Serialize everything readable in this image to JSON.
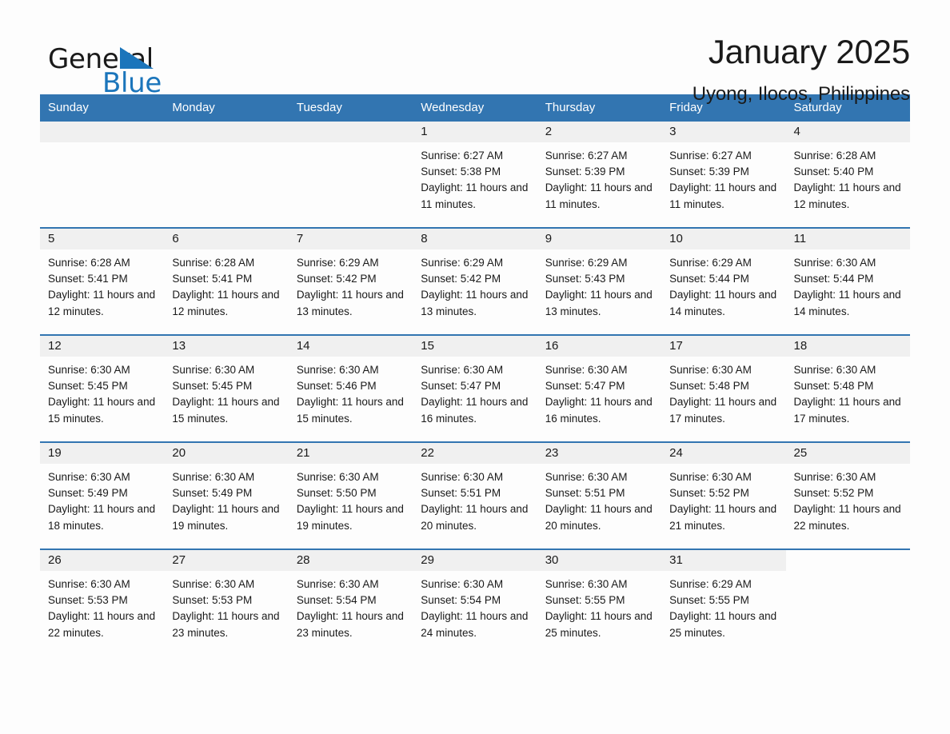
{
  "brand": {
    "word1": "General",
    "word2": "Blue",
    "triangle_color": "#1b75bb"
  },
  "header": {
    "title": "January 2025",
    "subtitle": "Uyong, Ilocos, Philippines"
  },
  "theme": {
    "header_blue": "#3275b1",
    "daynum_band": "#f0f0f0",
    "page_bg": "#fdfdfd",
    "text": "#1a1a1a"
  },
  "weekday_headers": [
    "Sunday",
    "Monday",
    "Tuesday",
    "Wednesday",
    "Thursday",
    "Friday",
    "Saturday"
  ],
  "labels": {
    "sunrise_prefix": "Sunrise:",
    "sunset_prefix": "Sunset:",
    "daylight_prefix": "Daylight:"
  },
  "weeks": [
    [
      {
        "day": "",
        "sunrise": "",
        "sunset": "",
        "daylight": "",
        "empty": true
      },
      {
        "day": "",
        "sunrise": "",
        "sunset": "",
        "daylight": "",
        "empty": true
      },
      {
        "day": "",
        "sunrise": "",
        "sunset": "",
        "daylight": "",
        "empty": true
      },
      {
        "day": "1",
        "sunrise": "Sunrise: 6:27 AM",
        "sunset": "Sunset: 5:38 PM",
        "daylight": "Daylight: 11 hours and 11 minutes."
      },
      {
        "day": "2",
        "sunrise": "Sunrise: 6:27 AM",
        "sunset": "Sunset: 5:39 PM",
        "daylight": "Daylight: 11 hours and 11 minutes."
      },
      {
        "day": "3",
        "sunrise": "Sunrise: 6:27 AM",
        "sunset": "Sunset: 5:39 PM",
        "daylight": "Daylight: 11 hours and 11 minutes."
      },
      {
        "day": "4",
        "sunrise": "Sunrise: 6:28 AM",
        "sunset": "Sunset: 5:40 PM",
        "daylight": "Daylight: 11 hours and 12 minutes."
      }
    ],
    [
      {
        "day": "5",
        "sunrise": "Sunrise: 6:28 AM",
        "sunset": "Sunset: 5:41 PM",
        "daylight": "Daylight: 11 hours and 12 minutes."
      },
      {
        "day": "6",
        "sunrise": "Sunrise: 6:28 AM",
        "sunset": "Sunset: 5:41 PM",
        "daylight": "Daylight: 11 hours and 12 minutes."
      },
      {
        "day": "7",
        "sunrise": "Sunrise: 6:29 AM",
        "sunset": "Sunset: 5:42 PM",
        "daylight": "Daylight: 11 hours and 13 minutes."
      },
      {
        "day": "8",
        "sunrise": "Sunrise: 6:29 AM",
        "sunset": "Sunset: 5:42 PM",
        "daylight": "Daylight: 11 hours and 13 minutes."
      },
      {
        "day": "9",
        "sunrise": "Sunrise: 6:29 AM",
        "sunset": "Sunset: 5:43 PM",
        "daylight": "Daylight: 11 hours and 13 minutes."
      },
      {
        "day": "10",
        "sunrise": "Sunrise: 6:29 AM",
        "sunset": "Sunset: 5:44 PM",
        "daylight": "Daylight: 11 hours and 14 minutes."
      },
      {
        "day": "11",
        "sunrise": "Sunrise: 6:30 AM",
        "sunset": "Sunset: 5:44 PM",
        "daylight": "Daylight: 11 hours and 14 minutes."
      }
    ],
    [
      {
        "day": "12",
        "sunrise": "Sunrise: 6:30 AM",
        "sunset": "Sunset: 5:45 PM",
        "daylight": "Daylight: 11 hours and 15 minutes."
      },
      {
        "day": "13",
        "sunrise": "Sunrise: 6:30 AM",
        "sunset": "Sunset: 5:45 PM",
        "daylight": "Daylight: 11 hours and 15 minutes."
      },
      {
        "day": "14",
        "sunrise": "Sunrise: 6:30 AM",
        "sunset": "Sunset: 5:46 PM",
        "daylight": "Daylight: 11 hours and 15 minutes."
      },
      {
        "day": "15",
        "sunrise": "Sunrise: 6:30 AM",
        "sunset": "Sunset: 5:47 PM",
        "daylight": "Daylight: 11 hours and 16 minutes."
      },
      {
        "day": "16",
        "sunrise": "Sunrise: 6:30 AM",
        "sunset": "Sunset: 5:47 PM",
        "daylight": "Daylight: 11 hours and 16 minutes."
      },
      {
        "day": "17",
        "sunrise": "Sunrise: 6:30 AM",
        "sunset": "Sunset: 5:48 PM",
        "daylight": "Daylight: 11 hours and 17 minutes."
      },
      {
        "day": "18",
        "sunrise": "Sunrise: 6:30 AM",
        "sunset": "Sunset: 5:48 PM",
        "daylight": "Daylight: 11 hours and 17 minutes."
      }
    ],
    [
      {
        "day": "19",
        "sunrise": "Sunrise: 6:30 AM",
        "sunset": "Sunset: 5:49 PM",
        "daylight": "Daylight: 11 hours and 18 minutes."
      },
      {
        "day": "20",
        "sunrise": "Sunrise: 6:30 AM",
        "sunset": "Sunset: 5:49 PM",
        "daylight": "Daylight: 11 hours and 19 minutes."
      },
      {
        "day": "21",
        "sunrise": "Sunrise: 6:30 AM",
        "sunset": "Sunset: 5:50 PM",
        "daylight": "Daylight: 11 hours and 19 minutes."
      },
      {
        "day": "22",
        "sunrise": "Sunrise: 6:30 AM",
        "sunset": "Sunset: 5:51 PM",
        "daylight": "Daylight: 11 hours and 20 minutes."
      },
      {
        "day": "23",
        "sunrise": "Sunrise: 6:30 AM",
        "sunset": "Sunset: 5:51 PM",
        "daylight": "Daylight: 11 hours and 20 minutes."
      },
      {
        "day": "24",
        "sunrise": "Sunrise: 6:30 AM",
        "sunset": "Sunset: 5:52 PM",
        "daylight": "Daylight: 11 hours and 21 minutes."
      },
      {
        "day": "25",
        "sunrise": "Sunrise: 6:30 AM",
        "sunset": "Sunset: 5:52 PM",
        "daylight": "Daylight: 11 hours and 22 minutes."
      }
    ],
    [
      {
        "day": "26",
        "sunrise": "Sunrise: 6:30 AM",
        "sunset": "Sunset: 5:53 PM",
        "daylight": "Daylight: 11 hours and 22 minutes."
      },
      {
        "day": "27",
        "sunrise": "Sunrise: 6:30 AM",
        "sunset": "Sunset: 5:53 PM",
        "daylight": "Daylight: 11 hours and 23 minutes."
      },
      {
        "day": "28",
        "sunrise": "Sunrise: 6:30 AM",
        "sunset": "Sunset: 5:54 PM",
        "daylight": "Daylight: 11 hours and 23 minutes."
      },
      {
        "day": "29",
        "sunrise": "Sunrise: 6:30 AM",
        "sunset": "Sunset: 5:54 PM",
        "daylight": "Daylight: 11 hours and 24 minutes."
      },
      {
        "day": "30",
        "sunrise": "Sunrise: 6:30 AM",
        "sunset": "Sunset: 5:55 PM",
        "daylight": "Daylight: 11 hours and 25 minutes."
      },
      {
        "day": "31",
        "sunrise": "Sunrise: 6:29 AM",
        "sunset": "Sunset: 5:55 PM",
        "daylight": "Daylight: 11 hours and 25 minutes."
      },
      {
        "day": "",
        "sunrise": "",
        "sunset": "",
        "daylight": "",
        "empty": true,
        "noband": true
      }
    ]
  ]
}
